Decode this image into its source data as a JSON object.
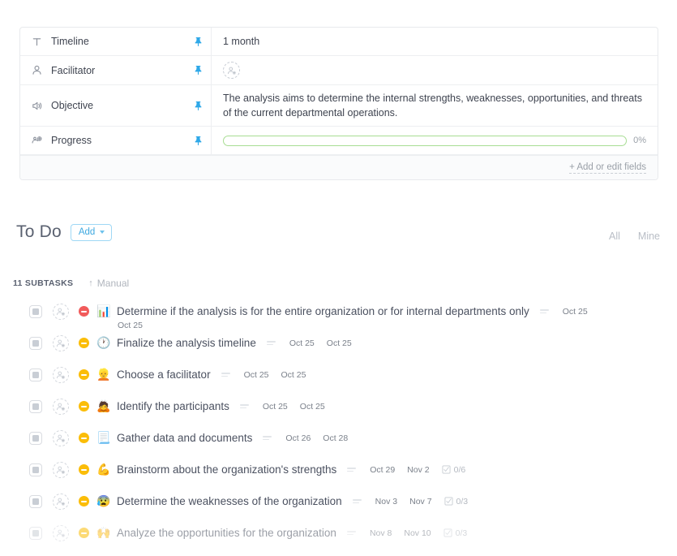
{
  "fields": {
    "rows": [
      {
        "icon": "text-field-icon",
        "label": "Timeline",
        "pin": "pin-icon",
        "value": "1 month",
        "type": "text"
      },
      {
        "icon": "person-icon",
        "label": "Facilitator",
        "pin": "pin-icon",
        "value": "",
        "type": "assignee"
      },
      {
        "icon": "announcement-icon",
        "label": "Objective",
        "pin": "pin-icon",
        "value": "The analysis aims to determine the internal strengths, weaknesses, opportunities, and threats of the current departmental operations.",
        "type": "text"
      },
      {
        "icon": "progress-icon",
        "label": "Progress",
        "pin": "pin-icon",
        "value": "0%",
        "type": "progress",
        "percent": 0
      }
    ],
    "footer_link": "+ Add or edit fields",
    "progress_color": "#a8dd93",
    "pin_color": "#2ea8e8"
  },
  "todo": {
    "title": "To Do",
    "add_label": "Add",
    "tabs": [
      {
        "label": "All"
      },
      {
        "label": "Mine"
      }
    ],
    "subtasks_count_label": "11 SUBTASKS",
    "sort_arrow": "↑",
    "sort_label": "Manual"
  },
  "subtasks": [
    {
      "title": "Determine if the analysis is for the entire organization or for internal departments only",
      "priority": "urgent",
      "priority_color": "#f15b5b",
      "emoji": "📊",
      "start_date": "Oct 25",
      "due_date": "",
      "second_line_date": "Oct 25",
      "checklist": ""
    },
    {
      "title": "Finalize the analysis timeline",
      "priority": "normal",
      "priority_color": "#fbbd08",
      "emoji": "🕐",
      "start_date": "Oct 25",
      "due_date": "Oct 25",
      "second_line_date": "",
      "checklist": ""
    },
    {
      "title": "Choose a facilitator",
      "priority": "normal",
      "priority_color": "#fbbd08",
      "emoji": "👱",
      "start_date": "Oct 25",
      "due_date": "Oct 25",
      "second_line_date": "",
      "checklist": ""
    },
    {
      "title": "Identify the participants",
      "priority": "normal",
      "priority_color": "#fbbd08",
      "emoji": "🙇",
      "start_date": "Oct 25",
      "due_date": "Oct 25",
      "second_line_date": "",
      "checklist": ""
    },
    {
      "title": "Gather data and documents",
      "priority": "normal",
      "priority_color": "#fbbd08",
      "emoji": "📃",
      "start_date": "Oct 26",
      "due_date": "Oct 28",
      "second_line_date": "",
      "checklist": ""
    },
    {
      "title": "Brainstorm about the organization's strengths",
      "priority": "normal",
      "priority_color": "#fbbd08",
      "emoji": "💪",
      "start_date": "Oct 29",
      "due_date": "Nov 2",
      "second_line_date": "",
      "checklist": "0/6"
    },
    {
      "title": "Determine the weaknesses of the organization",
      "priority": "normal",
      "priority_color": "#fbbd08",
      "emoji": "😰",
      "start_date": "Nov 3",
      "due_date": "Nov 7",
      "second_line_date": "",
      "checklist": "0/3"
    },
    {
      "title": "Analyze the opportunities for the organization",
      "priority": "normal",
      "priority_color": "#fbbd08",
      "emoji": "🙌",
      "start_date": "Nov 8",
      "due_date": "Nov 10",
      "second_line_date": "",
      "checklist": "0/3"
    }
  ]
}
